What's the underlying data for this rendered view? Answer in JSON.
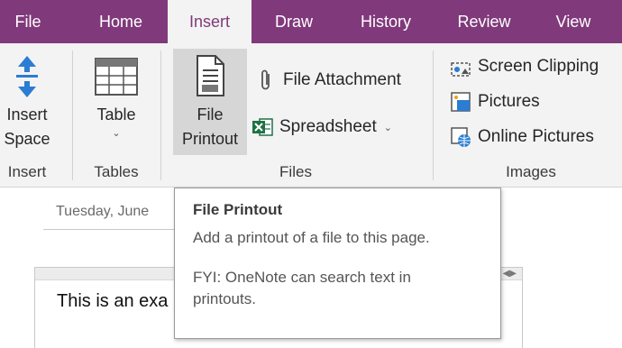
{
  "tabs": [
    {
      "label": "File",
      "active": false
    },
    {
      "label": "Home",
      "active": false
    },
    {
      "label": "Insert",
      "active": true
    },
    {
      "label": "Draw",
      "active": false
    },
    {
      "label": "History",
      "active": false
    },
    {
      "label": "Review",
      "active": false
    },
    {
      "label": "View",
      "active": false
    }
  ],
  "ribbon": {
    "insert_group": {
      "label": "Insert",
      "insert_space": {
        "line1": "Insert",
        "line2": "Space",
        "icon": "insert-space-arrows-icon"
      }
    },
    "tables_group": {
      "label": "Tables",
      "table": {
        "label": "Table",
        "icon": "table-grid-icon"
      }
    },
    "files_group": {
      "label": "Files",
      "file_printout": {
        "line1": "File",
        "line2": "Printout",
        "icon": "file-printout-icon"
      },
      "file_attachment": {
        "label": "File Attachment",
        "icon": "paperclip-icon"
      },
      "spreadsheet": {
        "label": "Spreadsheet",
        "icon": "excel-icon"
      }
    },
    "images_group": {
      "label": "Images",
      "screen_clipping": {
        "label": "Screen Clipping",
        "icon": "screen-clipping-icon"
      },
      "pictures": {
        "label": "Pictures",
        "icon": "pictures-icon"
      },
      "online_pictures": {
        "label": "Online Pictures",
        "icon": "online-pictures-icon"
      }
    }
  },
  "page": {
    "date": "Tuesday, June",
    "note_text": "This is an exa"
  },
  "tooltip": {
    "title": "File Printout",
    "description": "Add a printout of a file to this page.",
    "fyi": "FYI: OneNote can search text in printouts."
  },
  "colors": {
    "accent": "#80397b",
    "ribbon_bg": "#f3f3f3",
    "excel_green": "#1e7145",
    "blue_icon": "#2b7cd3"
  }
}
